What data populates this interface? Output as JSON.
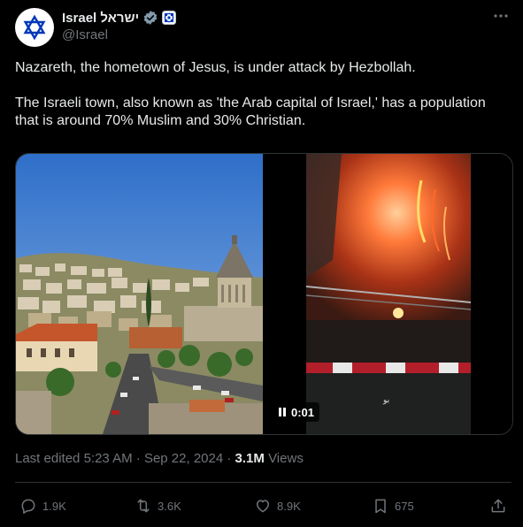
{
  "author": {
    "display_name": "Israel ישראל",
    "handle": "@Israel",
    "verified_icon": "gray-check-badge-icon",
    "affiliate_icon": "government-affiliate-icon"
  },
  "tweet": {
    "text_paragraphs": [
      "Nazareth, the hometown of Jesus, is under attack by Hezbollah.",
      "The Israeli town, also known as 'the Arab capital of Israel,' has a population that is around 70% Muslim and 30% Christian."
    ]
  },
  "media": {
    "video": {
      "duration_label": "0:01",
      "caption_text": "بو"
    }
  },
  "meta": {
    "edited_label": "Last edited",
    "time": "5:23 AM",
    "separator": "·",
    "date": "Sep 22, 2024",
    "views_count": "3.1M",
    "views_label": "Views"
  },
  "actions": {
    "replies": "1.9K",
    "reposts": "3.6K",
    "likes": "8.9K",
    "bookmarks": "675"
  },
  "colors": {
    "background": "#000000",
    "text_primary": "#e7e9ea",
    "text_secondary": "#71767b",
    "border": "#2f3336",
    "flag_blue": "#0038b8"
  }
}
